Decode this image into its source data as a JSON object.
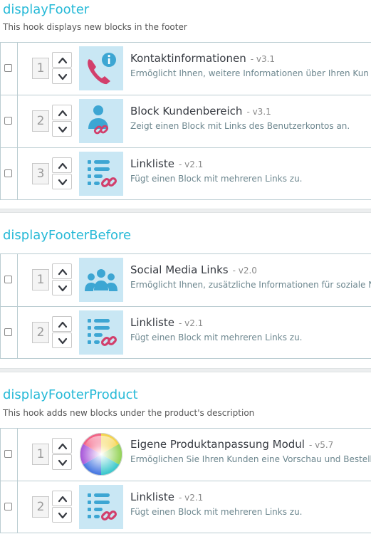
{
  "hooks": [
    {
      "title": "displayFooter",
      "description": "This hook displays new blocks in the footer",
      "modules": [
        {
          "position": "1",
          "name": "Kontaktinformationen",
          "version": "- v3.1",
          "description": "Ermöglicht Ihnen, weitere Informationen über Ihren Kun",
          "icon": "contact-phone-info-icon"
        },
        {
          "position": "2",
          "name": "Block Kundenbereich",
          "version": "- v3.1",
          "description": "Zeigt einen Block mit Links des Benutzerkontos an.",
          "icon": "user-link-icon"
        },
        {
          "position": "3",
          "name": "Linkliste",
          "version": "- v2.1",
          "description": "Fügt einen Block mit mehreren Links zu.",
          "icon": "link-list-icon"
        }
      ]
    },
    {
      "title": "displayFooterBefore",
      "description": "",
      "modules": [
        {
          "position": "1",
          "name": "Social Media Links",
          "version": "- v2.0",
          "description": "Ermöglicht Ihnen, zusätzliche Informationen für soziale N",
          "icon": "social-group-icon"
        },
        {
          "position": "2",
          "name": "Linkliste",
          "version": "- v2.1",
          "description": "Fügt einen Block mit mehreren Links zu.",
          "icon": "link-list-icon"
        }
      ]
    },
    {
      "title": "displayFooterProduct",
      "description": "This hook adds new blocks under the product's description",
      "modules": [
        {
          "position": "1",
          "name": "Eigene Produktanpassung Modul",
          "version": "- v5.7",
          "description": "Ermöglichen Sie Ihren Kunden eine Vorschau und Bestell",
          "icon": "color-wheel-icon"
        },
        {
          "position": "2",
          "name": "Linkliste",
          "version": "- v2.1",
          "description": "Fügt einen Block mit mehreren Links zu.",
          "icon": "link-list-icon"
        }
      ]
    }
  ],
  "colors": {
    "hook_title": "#25b9d7",
    "icon_background": "#c9e7f4",
    "icon_blue": "#3da6d3",
    "icon_pink": "#d23f6c",
    "border": "#bbcdd2"
  }
}
